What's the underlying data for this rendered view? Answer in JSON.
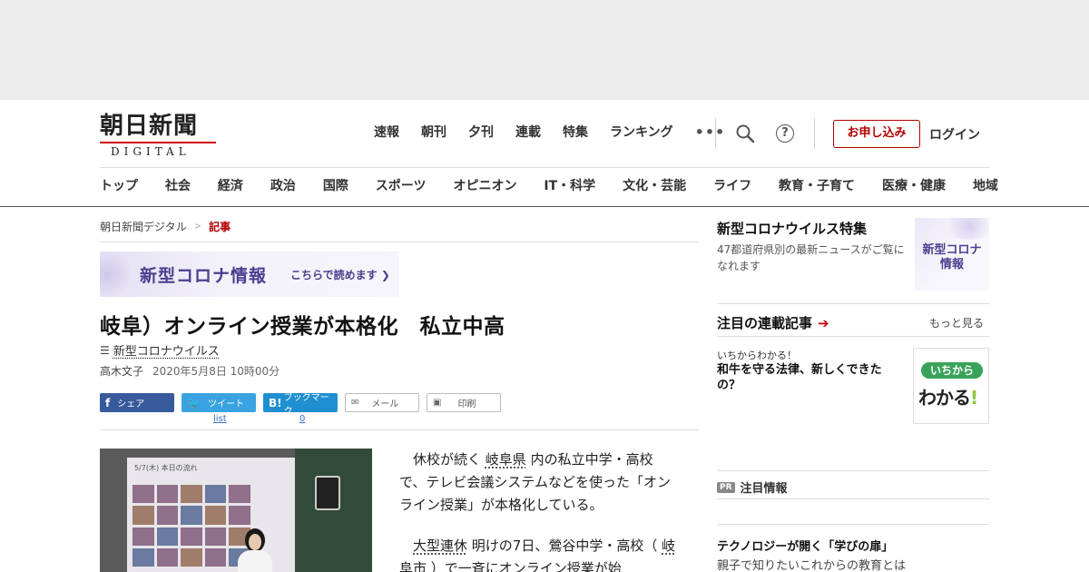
{
  "header": {
    "logo_main": "朝日新聞",
    "logo_sub": "DIGITAL",
    "main_nav": [
      "速報",
      "朝刊",
      "夕刊",
      "連載",
      "特集",
      "ランキング"
    ],
    "more": "•••",
    "help": "?",
    "apply_label": "お申し込み",
    "login_label": "ログイン"
  },
  "category_nav": [
    "トップ",
    "社会",
    "経済",
    "政治",
    "国際",
    "スポーツ",
    "オピニオン",
    "IT・科学",
    "文化・芸能",
    "ライフ",
    "教育・子育て",
    "医療・健康",
    "地域"
  ],
  "breadcrumb": {
    "home": "朝日新聞デジタル",
    "separator": ">",
    "current": "記事"
  },
  "corona_banner": {
    "title": "新型コロナ情報",
    "link": "こちらで読めます ❯"
  },
  "article": {
    "headline": "岐阜）オンライン授業が本格化　私立中高",
    "topic": "新型コロナウイルス",
    "author": "高木文子",
    "date": "2020年5月8日 10時00分",
    "photo_screen_title": "5/7(木) 本日の流れ",
    "p1_a": "休校が続く",
    "p1_kw": "岐阜県",
    "p1_b": "内の私立中学・高校で、テレビ会議システムなどを使った「オンライン授業」が本格化している。",
    "p2_kw1": "大型連休",
    "p2_a": "明けの7日、鶯谷中学・高校（",
    "p2_kw2": "岐阜市",
    "p2_b": "）で一斉にオンライン授業が始"
  },
  "share": {
    "facebook": "シェア",
    "twitter": "ツイート",
    "twitter_count": "list",
    "hatena": "ブックマーク",
    "hatena_count": "0",
    "mail": "メール",
    "print": "印刷"
  },
  "sidebar": {
    "feature_title": "新型コロナウイルス特集",
    "feature_desc": "47都道府県別の最新ニュースがご覧になれます",
    "feature_img_text": "新型コロナ\n情報",
    "serial_heading": "注目の連載記事",
    "serial_more": "もっと見る",
    "serial_kicker": "いちからわかる！",
    "serial_title": "和牛を守る法律、新しくできたの？",
    "serial_img_pill": "いちから",
    "serial_img_big": "わかる",
    "serial_img_excl": "!",
    "pr_badge": "PR",
    "pr_heading": "注目情報",
    "pr_title": "テクノロジーが開く「学びの扉」",
    "pr_desc": "親子で知りたいこれからの教育とは"
  },
  "colors": {
    "accent_red": "#b30000",
    "facebook": "#365a9b",
    "twitter": "#3aa2e0",
    "hatena": "#1f8fd1",
    "corona_purple": "#4a3f8f"
  }
}
